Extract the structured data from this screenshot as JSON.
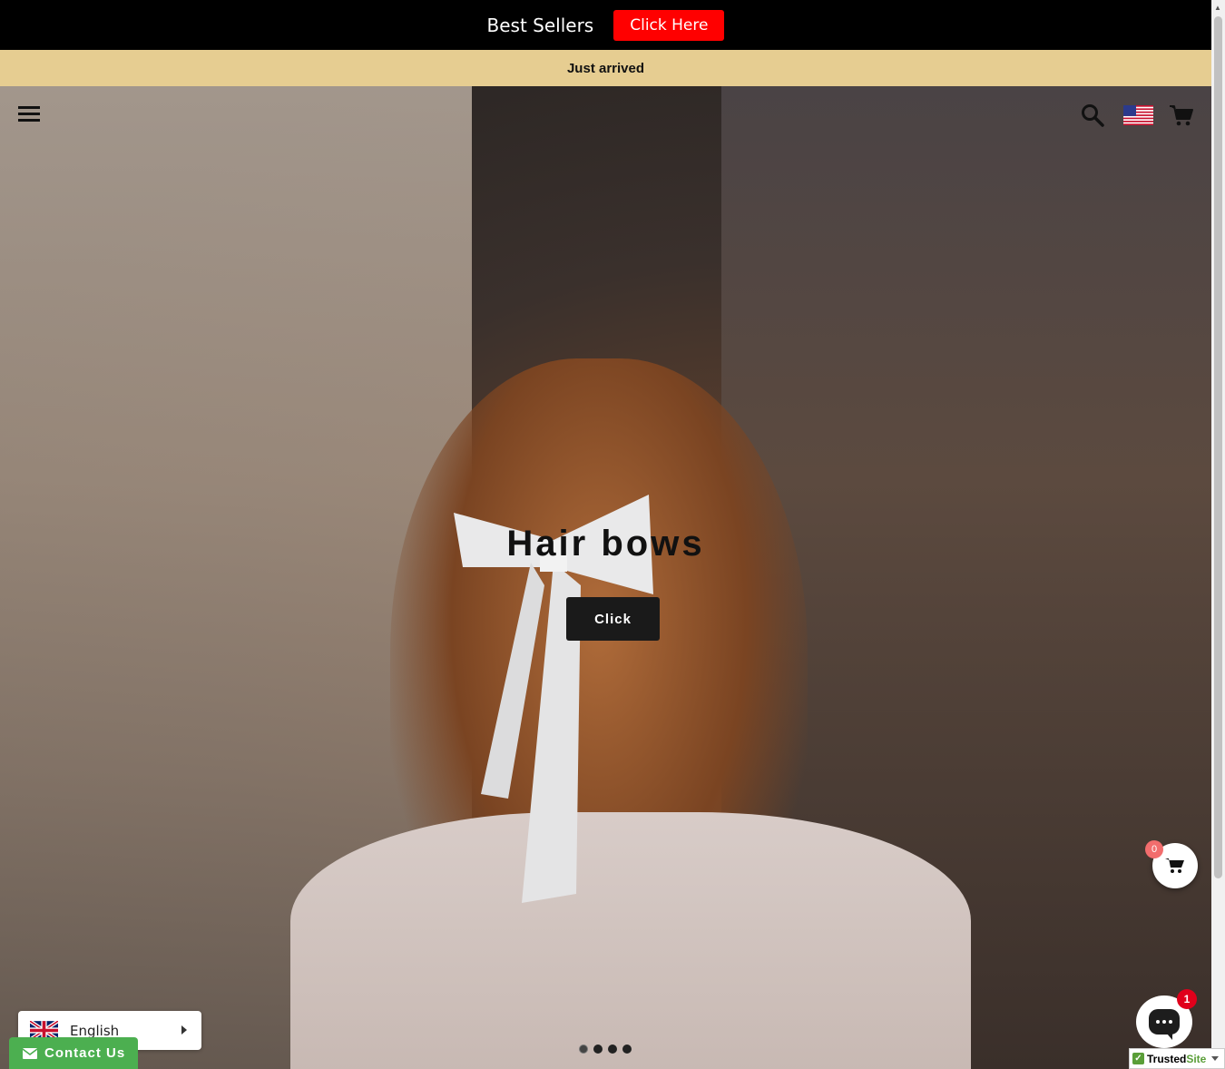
{
  "topbar": {
    "promo_text": "Best Sellers",
    "promo_button": "Click Here",
    "button_color": "#ff0000"
  },
  "announcement": {
    "text": "Just arrived",
    "background": "#e6cd91"
  },
  "hero": {
    "title": "Hair bows",
    "button_label": "Click",
    "slide_count": 4,
    "active_slide": 1
  },
  "header_icons": [
    "menu-icon",
    "search-icon",
    "us-flag-icon",
    "cart-icon"
  ],
  "floating_cart": {
    "count": "0"
  },
  "language": {
    "label": "English",
    "flag": "uk-flag-icon"
  },
  "contact": {
    "label": "Contact Us"
  },
  "chat": {
    "badge": "1"
  },
  "trusted_site": {
    "prefix": "Trusted",
    "suffix": "Site"
  }
}
